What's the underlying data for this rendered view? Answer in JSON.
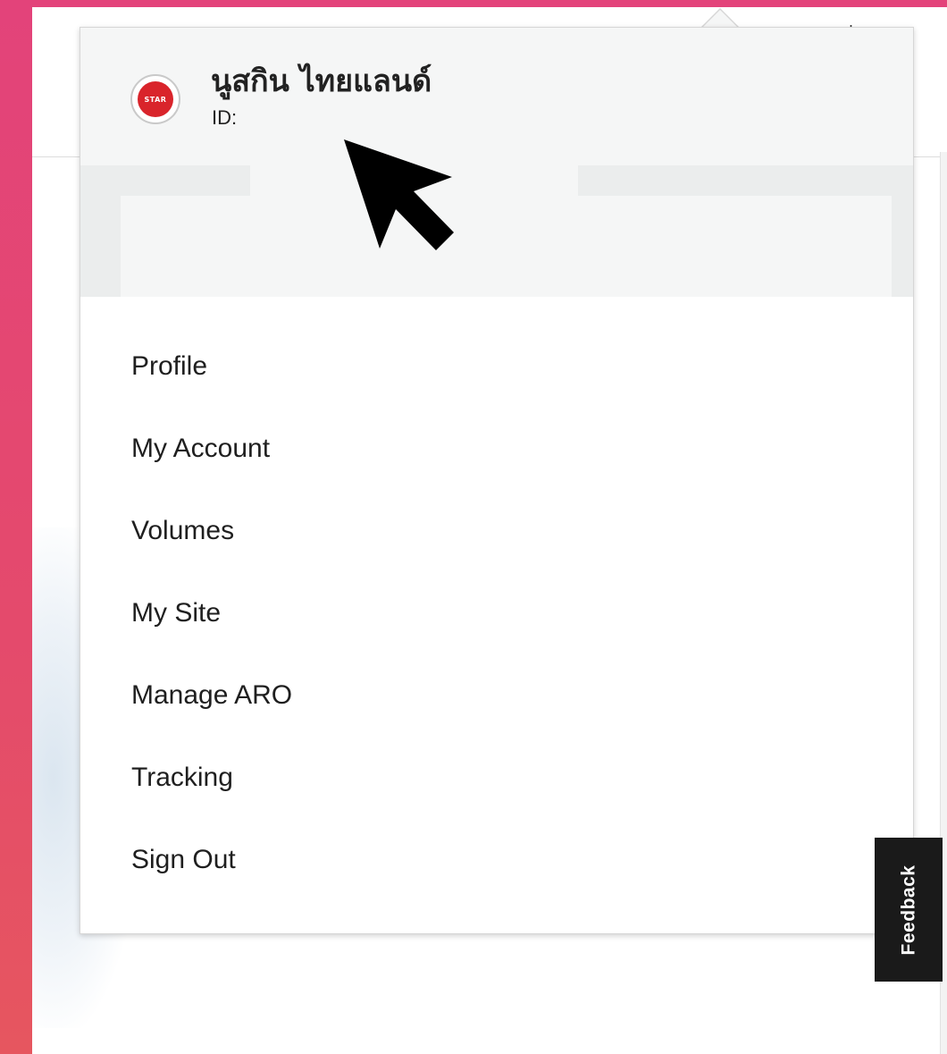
{
  "user": {
    "name": "นูสกิน ไทยแลนด์",
    "id_label": "ID:",
    "avatar_text": "STAR"
  },
  "menu": {
    "items": [
      {
        "label": "Profile"
      },
      {
        "label": "My Account"
      },
      {
        "label": "Volumes"
      },
      {
        "label": "My Site"
      },
      {
        "label": "Manage ARO"
      },
      {
        "label": "Tracking"
      },
      {
        "label": "Sign Out"
      }
    ]
  },
  "feedback": {
    "label": "Feedback"
  },
  "colors": {
    "frame_accent": "#e3437a",
    "header_bg": "#f5f6f6",
    "feedback_bg": "#1a1a1a",
    "avatar_red": "#d9242b"
  }
}
